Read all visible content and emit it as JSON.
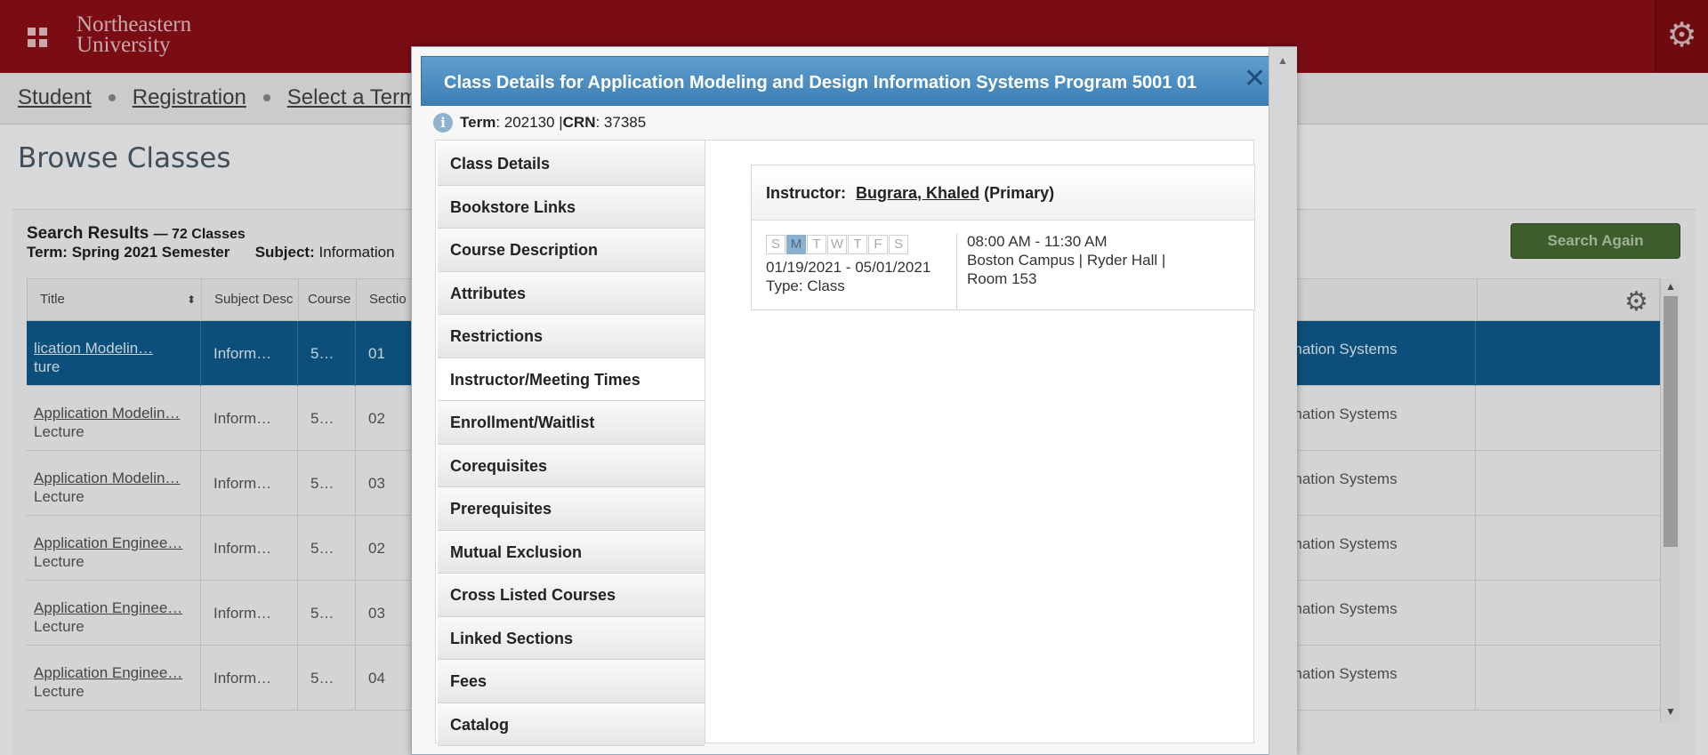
{
  "header": {
    "logo_line1": "Northeastern",
    "logo_line2": "University"
  },
  "breadcrumb": [
    "Student",
    "Registration",
    "Select a Term"
  ],
  "page_title": "Browse Classes",
  "results": {
    "title": "Search Results",
    "count": "— 72 Classes",
    "term_label": "Term: Spring 2021 Semester",
    "subject_label": "Subject:",
    "subject_value": "Information"
  },
  "search_again_label": "Search Again",
  "table": {
    "headers": [
      "Title",
      "Subject Desc",
      "Course",
      "Sectio"
    ],
    "rows": [
      {
        "title": "lication Modelin…",
        "type": "ture",
        "subject": "Inform…",
        "course": "5…",
        "section": "01",
        "attr": "rmation Systems",
        "selected": true
      },
      {
        "title": "Application Modelin…",
        "type": "Lecture",
        "subject": "Inform…",
        "course": "5…",
        "section": "02",
        "attr": "rmation Systems"
      },
      {
        "title": "Application Modelin…",
        "type": "Lecture",
        "subject": "Inform…",
        "course": "5…",
        "section": "03",
        "attr": "rmation Systems"
      },
      {
        "title": "Application Enginee…",
        "type": "Lecture",
        "subject": "Inform…",
        "course": "5…",
        "section": "02",
        "attr": "rmation Systems"
      },
      {
        "title": "Application Enginee…",
        "type": "Lecture",
        "subject": "Inform…",
        "course": "5…",
        "section": "03",
        "attr": "rmation Systems"
      },
      {
        "title": "Application Enginee…",
        "type": "Lecture",
        "subject": "Inform…",
        "course": "5…",
        "section": "04",
        "attr": "rmation Systems"
      }
    ]
  },
  "modal": {
    "title": "Class Details for Application Modeling and Design Information Systems Program 5001 01",
    "term_label": "Term",
    "term_value": ": 202130 | ",
    "crn_label": "CRN",
    "crn_value": ": 37385",
    "tabs": [
      "Class Details",
      "Bookstore Links",
      "Course Description",
      "Attributes",
      "Restrictions",
      "Instructor/Meeting Times",
      "Enrollment/Waitlist",
      "Corequisites",
      "Prerequisites",
      "Mutual Exclusion",
      "Cross Listed Courses",
      "Linked Sections",
      "Fees",
      "Catalog"
    ],
    "active_tab": "Instructor/Meeting Times",
    "instructor": {
      "label": "Instructor:",
      "name": "Bugrara, Khaled",
      "role": "(Primary)"
    },
    "meeting": {
      "days": [
        "S",
        "M",
        "T",
        "W",
        "T",
        "F",
        "S"
      ],
      "active_days": [
        1
      ],
      "dates": "01/19/2021 - 05/01/2021",
      "type": "Type: Class",
      "time": "08:00 AM - 11:30 AM",
      "location_line1": "Boston Campus | Ryder Hall |",
      "location_line2": "Room 153"
    }
  }
}
